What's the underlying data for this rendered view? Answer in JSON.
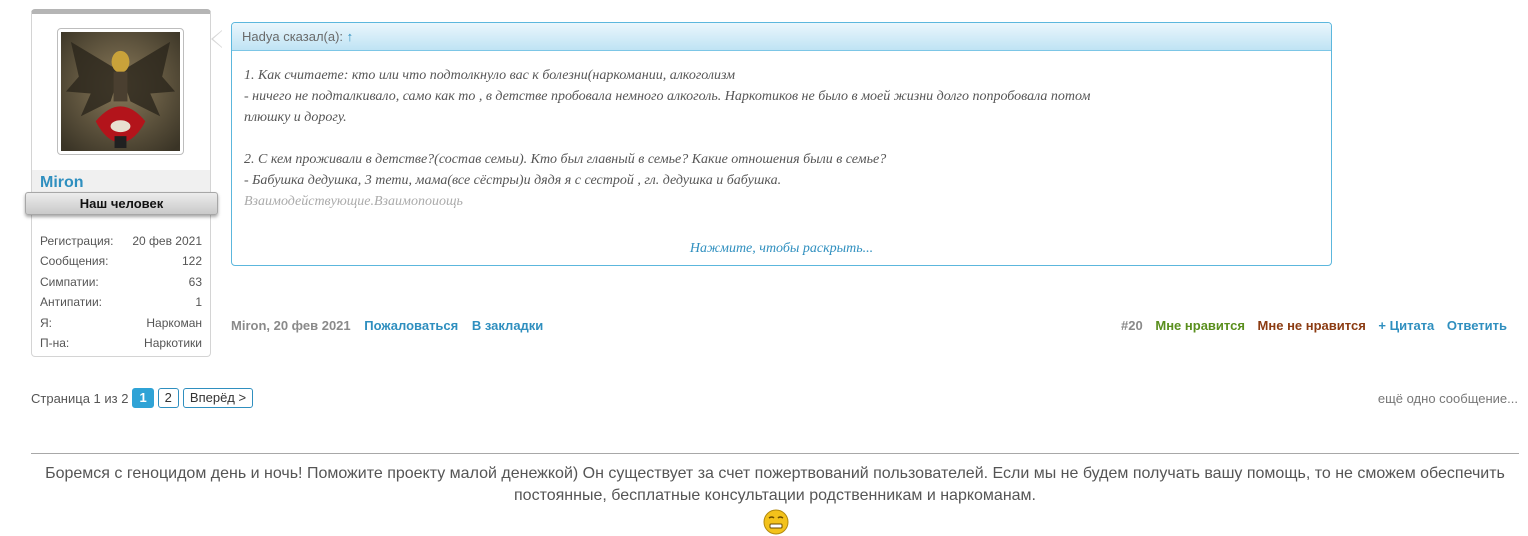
{
  "user": {
    "name": "Miron",
    "title": "Наш человек",
    "stats": [
      {
        "label": "Регистрация:",
        "value": "20 фев 2021"
      },
      {
        "label": "Сообщения:",
        "value": "122"
      },
      {
        "label": "Симпатии:",
        "value": "63"
      },
      {
        "label": "Антипатии:",
        "value": "1"
      },
      {
        "label": "Я:",
        "value": "Наркоман"
      },
      {
        "label": "П-на:",
        "value": "Наркотики"
      }
    ]
  },
  "quote": {
    "header": "Hadya сказал(а):",
    "header_arrow": "↑",
    "lines": [
      "1. Как считаете: кто или что подтолкнуло вас к болезни(наркомании, алкоголизм",
      "- ничего не подталкивало, само как то , в детстве пробовала немного алкоголь. Наркотиков не было в моей жизни долго попробовала потом",
      "плюшку и дорогу.",
      "2. С кем проживали в детстве?(состав семьи). Кто был главный в семье? Какие отношения были в семье?",
      "- Бабушка дедушка, 3 тети, мама(все сёстры)и дядя я с сестрой , гл. дедушка и бабушка.",
      "Взаимодействующие.Взаимопоиощь"
    ],
    "expand_label": "Нажмите, чтобы раскрыть..."
  },
  "post": {
    "author_date": "Miron, 20 фев 2021",
    "report_label": "Пожаловаться",
    "bookmark_label": "В закладки",
    "number": "#20",
    "like_label": "Мне нравится",
    "dislike_label": "Мне не нравится",
    "quote_label": "+ Цитата",
    "reply_label": "Ответить"
  },
  "pagination": {
    "label": "Страница 1 из 2",
    "pages": [
      "1",
      "2"
    ],
    "next_label": "Вперёд >",
    "more_messages": "ещё одно сообщение..."
  },
  "footer": {
    "donate_text": "Боремся с геноцидом день и ночь! Поможите проекту малой денежкой) Он существует за счет пожертвований пользователей. Если мы не будем получать вашу помощь, то не сможем обеспечить постоянные, бесплатные консультации родственникам и наркоманам."
  },
  "colors": {
    "accent": "#2f8fbf",
    "like": "#5a8f1e",
    "dislike": "#8b3b12"
  }
}
